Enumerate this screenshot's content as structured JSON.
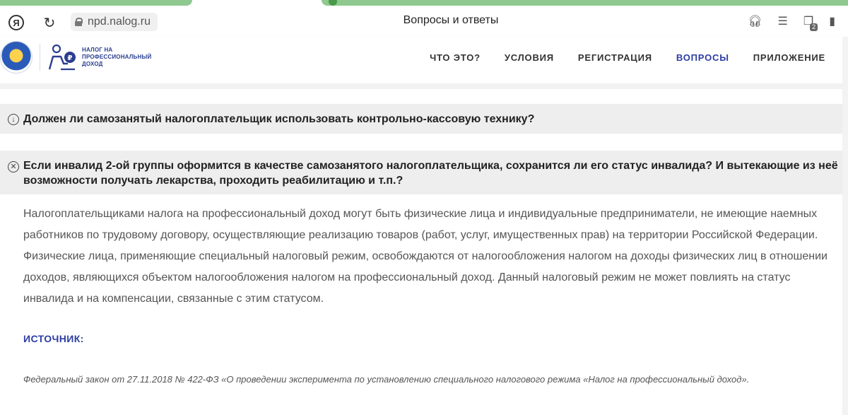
{
  "browser": {
    "url": "npd.nalog.ru",
    "page_title": "Вопросы и ответы",
    "yandex_label": "Я",
    "tabs_badge": "2"
  },
  "site": {
    "logo_text": [
      "НАЛОГ НА",
      "ПРОФЕССИОНАЛЬНЫЙ",
      "ДОХОД"
    ],
    "nav": [
      {
        "label": "ЧТО ЭТО?"
      },
      {
        "label": "УСЛОВИЯ"
      },
      {
        "label": "РЕГИСТРАЦИЯ"
      },
      {
        "label": "ВОПРОСЫ"
      },
      {
        "label": "ПРИЛОЖЕНИЕ"
      }
    ],
    "active_nav": "ВОПРОСЫ",
    "accent_color": "#2d3da3"
  },
  "faq": {
    "questions": [
      {
        "text": "Должен ли самозанятый налогоплательщик использовать контрольно-кассовую технику?",
        "state": "collapsed"
      },
      {
        "text": "Если инвалид 2-ой группы оформится в качестве самозанятого налогоплательщика, сохранится ли его статус инвалида? И вытекающие из неё возможности получать лекарства, проходить реабилитацию и т.п.?",
        "state": "expanded"
      }
    ],
    "answer": "Налогоплательщиками налога на профессиональный доход могут быть физические лица и индивидуальные предприниматели, не имеющие наемных работников по трудовому договору, осуществляющие реализацию товаров (работ, услуг, имущественных прав) на территории Российской Федерации. Физические лица, применяющие специальный налоговый режим, освобождаются от налогообложения налогом на доходы физических лиц в отношении доходов, являющихся объектом налогообложения налогом на профессиональный доход. Данный налоговый режим не может повлиять на статус инвалида и на компенсации, связанные с этим статусом.",
    "source_label": "ИСТОЧНИК:",
    "source_text": "Федеральный закон от 27.11.2018 № 422-ФЗ «О проведении эксперимента по установлению специального налогового режима «Налог на профессиональный доход»."
  }
}
